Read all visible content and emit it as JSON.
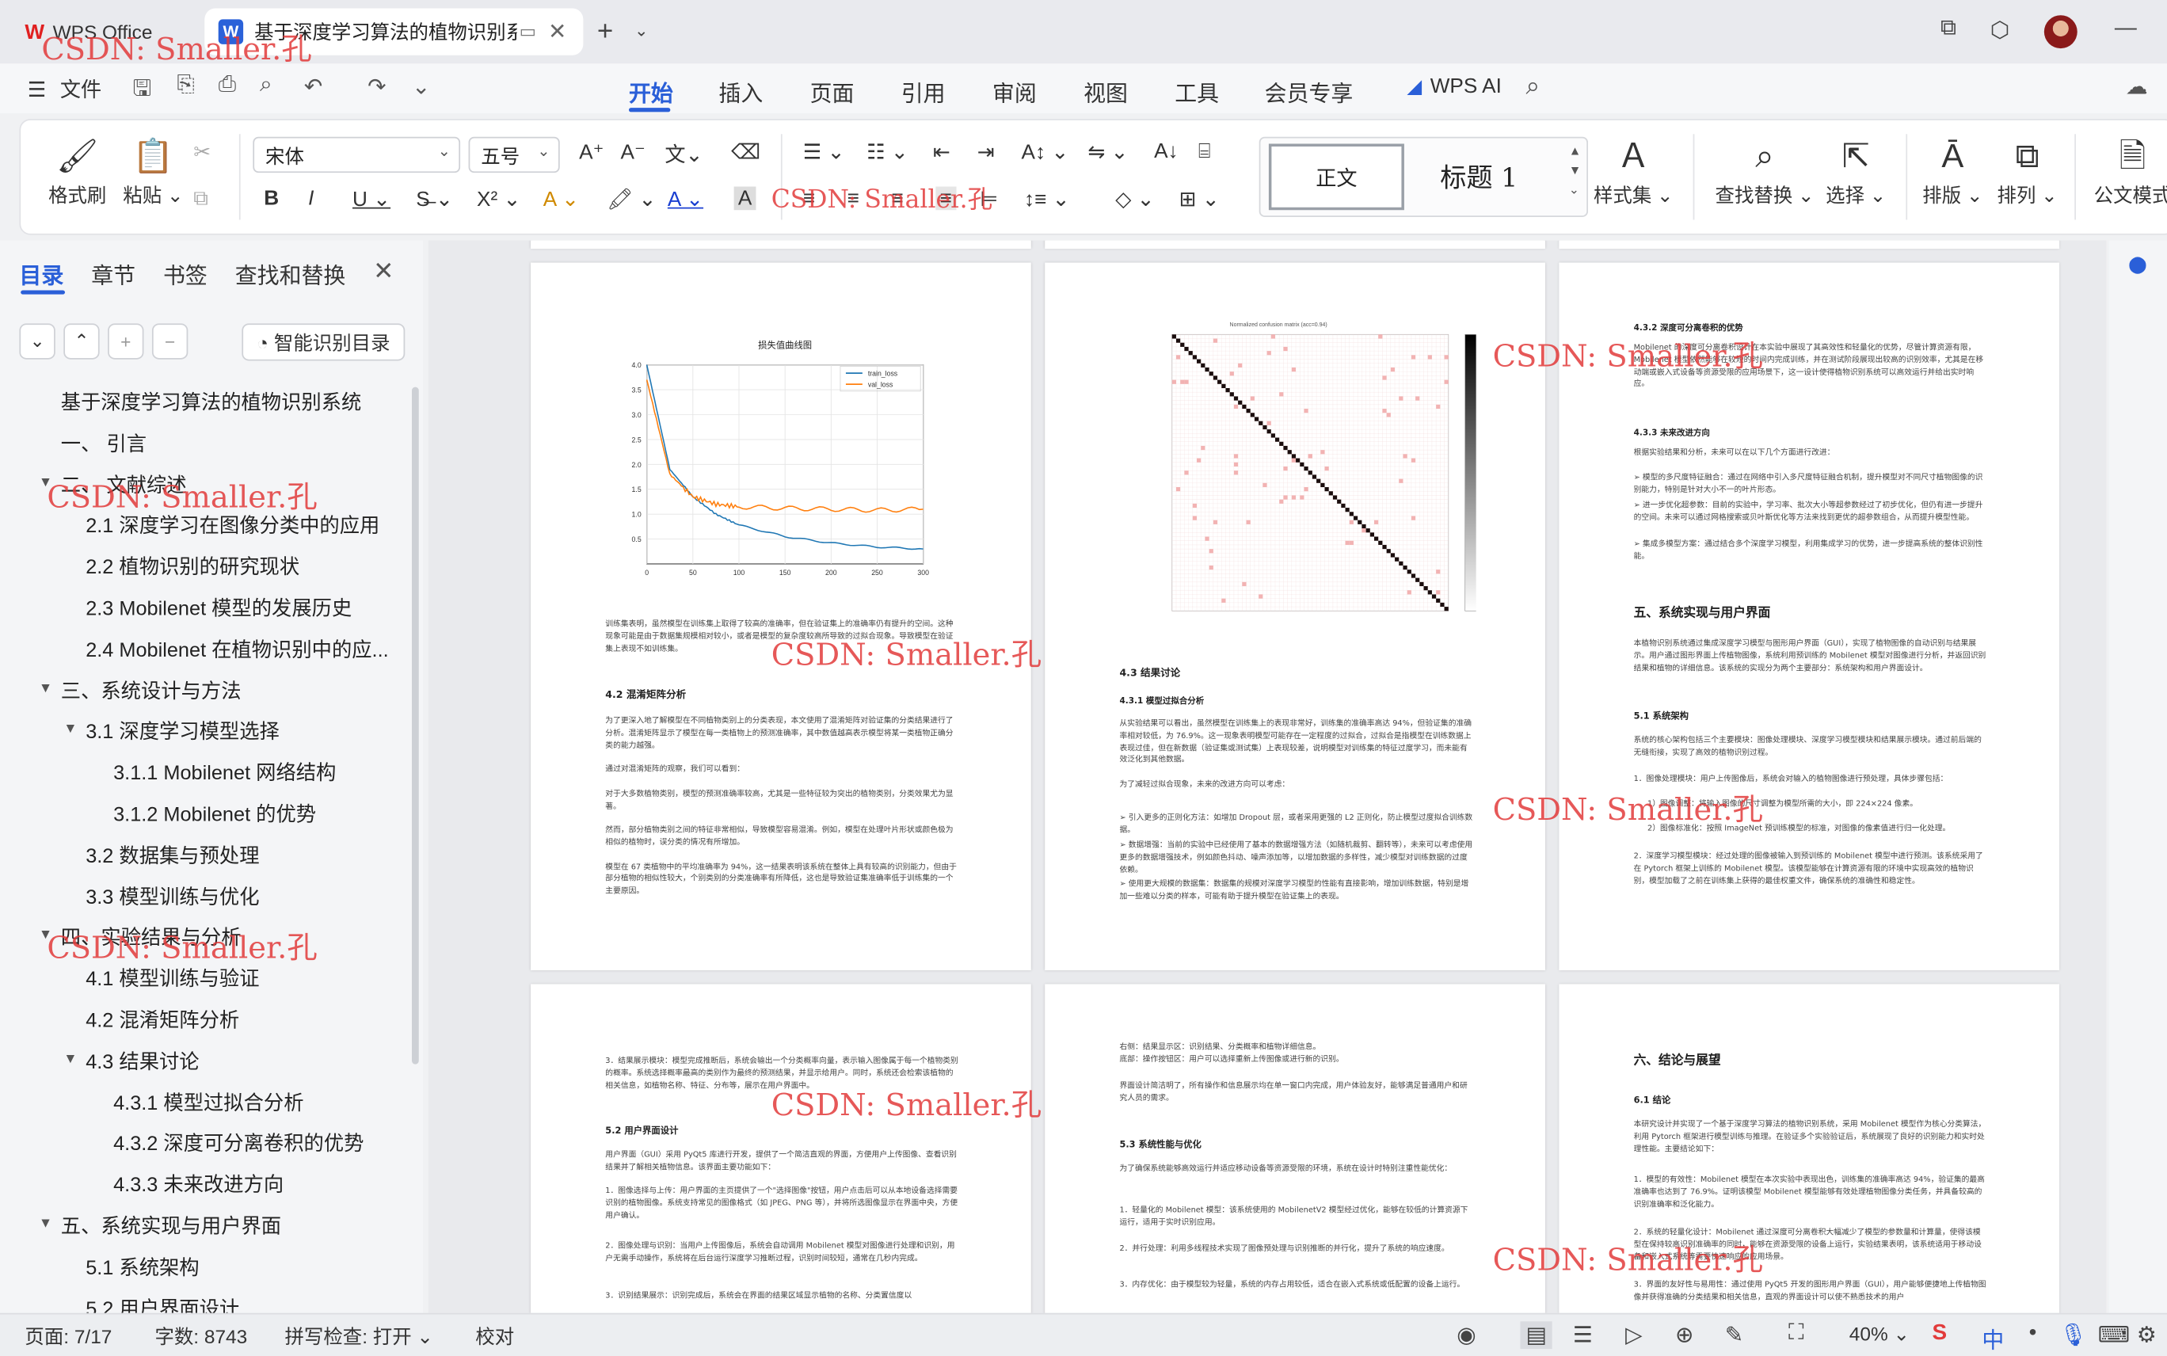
{
  "titlebar": {
    "app_tab": "WPS Office",
    "doc_tab": "基于深度学习算法的植物识别系",
    "new_tab": "+"
  },
  "menu": {
    "file_label": "文件",
    "tabs": [
      "开始",
      "插入",
      "页面",
      "引用",
      "审阅",
      "视图",
      "工具",
      "会员专享"
    ],
    "wps_ai": "WPS AI"
  },
  "ribbon": {
    "format_painter": "格式刷",
    "paste": "粘贴",
    "font_name": "宋体",
    "font_size": "五号",
    "style_normal": "正文",
    "style_h1": "标题 1",
    "styles_set": "样式集",
    "find_replace": "查找替换",
    "select": "选择",
    "layout": "排版",
    "arrange": "排列",
    "official_template": "公文模式"
  },
  "sidepanel": {
    "tabs": [
      "目录",
      "章节",
      "书签",
      "查找和替换"
    ],
    "smart_toc": "智能识别目录",
    "toc": [
      {
        "label": "基于深度学习算法的植物识别系统",
        "level": 0
      },
      {
        "label": "一、 引言",
        "level": 1
      },
      {
        "label": "二、 文献综述",
        "level": 1
      },
      {
        "label": "2.1 深度学习在图像分类中的应用",
        "level": 2
      },
      {
        "label": "2.2 植物识别的研究现状",
        "level": 2
      },
      {
        "label": "2.3 Mobilenet 模型的发展历史",
        "level": 2
      },
      {
        "label": "2.4 Mobilenet 在植物识别中的应...",
        "level": 2
      },
      {
        "label": "三、系统设计与方法",
        "level": 1
      },
      {
        "label": "3.1 深度学习模型选择",
        "level": 2
      },
      {
        "label": "3.1.1 Mobilenet 网络结构",
        "level": 3
      },
      {
        "label": "3.1.2 Mobilenet 的优势",
        "level": 3
      },
      {
        "label": "3.2 数据集与预处理",
        "level": 2
      },
      {
        "label": "3.3 模型训练与优化",
        "level": 2
      },
      {
        "label": "四、实验结果与分析",
        "level": 1
      },
      {
        "label": "4.1 模型训练与验证",
        "level": 2
      },
      {
        "label": "4.2 混淆矩阵分析",
        "level": 2
      },
      {
        "label": "4.3 结果讨论",
        "level": 2
      },
      {
        "label": "4.3.1 模型过拟合分析",
        "level": 3
      },
      {
        "label": "4.3.2 深度可分离卷积的优势",
        "level": 3
      },
      {
        "label": "4.3.3 未来改进方向",
        "level": 3
      },
      {
        "label": "五、系统实现与用户界面",
        "level": 1
      },
      {
        "label": "5.1 系统架构",
        "level": 2
      },
      {
        "label": "5.2 用户界面设计",
        "level": 2
      }
    ]
  },
  "pages": {
    "p1": {
      "chart_title": "损失值曲线图",
      "legend": [
        "train_loss",
        "val_loss"
      ],
      "text1": "训练集表明，虽然模型在训练集上取得了较高的准确率，但在验证集上的准确率仍有提升的空间。这种现象可能是由于数据集规模相对较小，或者是模型的复杂度较高所导致的过拟合现象。导致模型在验证集上表现不如训练集。",
      "h42": "4.2 混淆矩阵分析",
      "text2": "为了更深入地了解模型在不同植物类别上的分类表现，本文使用了混淆矩阵对验证集的分类结果进行了分析。混淆矩阵显示了模型在每一类植物上的预测准确率，其中数值越高表示模型将某一类植物正确分类的能力越强。\n\n通过对混淆矩阵的观察，我们可以看到：\n\n对于大多数植物类别，模型的预测准确率较高，尤其是一些特征较为突出的植物类别，分类效果尤为显著。\n\n然而，部分植物类别之间的特征非常相似，导致模型容易混淆。例如，模型在处理叶片形状或颜色极为相似的植物时，误分类的情况有所增加。\n\n模型在 67 类植物中的平均准确率为 94%，这一结果表明该系统在整体上具有较高的识别能力，但由于部分植物的相似性较大，个别类别的分类准确率有所降低，这也是导致验证集准确率低于训练集的一个主要原因。"
    },
    "p2": {
      "cm_title": "Normalized confusion matrix (acc=0.94)",
      "h43": "4.3 结果讨论",
      "h431": "4.3.1 模型过拟合分析",
      "text1": "从实验结果可以看出，虽然模型在训练集上的表现非常好，训练集的准确率高达 94%，但验证集的准确率相对较低，为 76.9%。这一现象表明模型可能存在一定程度的过拟合，过拟合是指模型在训练数据上表现过佳，但在新数据（验证集或测试集）上表现较差，说明模型对训练集的特征过度学习，而未能有效泛化到其他数据。\n\n为了减轻过拟合现象，未来的改进方向可以考虑：",
      "b1": "引入更多的正则化方法：如增加 Dropout 层，或者采用更强的 L2 正则化，防止模型过度拟合训练数据。",
      "b2": "数据增强：当前的实验中已经使用了基本的数据增强方法（如随机裁剪、翻转等），未来可以考虑使用更多的数据增强技术，例如颜色抖动、噪声添加等，以增加数据的多样性，减少模型对训练数据的过度依赖。",
      "b3": "使用更大规模的数据集：数据集的规模对深度学习模型的性能有直接影响，增加训练数据，特别是增加一些难以分类的样本，可能有助于提升模型在验证集上的表现。"
    },
    "p3": {
      "h432": "4.3.2 深度可分离卷积的优势",
      "text1": "Mobilenet 的深度可分离卷积设计在本实验中展现了其高效性和轻量化的优势，尽管计算资源有限，Mobilenet 模型依然能够在较短的时间内完成训练，并在测试阶段展现出较高的识别效率，尤其是在移动端或嵌入式设备等资源受限的应用场景下，这一设计使得植物识别系统可以高效运行并给出实时响应。",
      "h433": "4.3.3 未来改进方向",
      "text2": "根据实验结果和分析，未来可以在以下几个方面进行改进：",
      "b1": "模型的多尺度特征融合：通过在网络中引入多尺度特征融合机制，提升模型对不同尺寸植物图像的识别能力，特别是针对大小不一的叶片形态。",
      "b2": "进一步优化超参数：目前的实验中，学习率、批次大小等超参数经过了初步优化，但仍有进一步提升的空间。未来可以通过网格搜索或贝叶斯优化等方法来找到更优的超参数组合，从而提升模型性能。",
      "b3": "集成多模型方案：通过结合多个深度学习模型，利用集成学习的优势，进一步提高系统的整体识别性能。",
      "h5": "五、系统实现与用户界面",
      "text3": "本植物识别系统通过集成深度学习模型与图形用户界面（GUI），实现了植物图像的自动识别与结果展示。用户通过图形界面上传植物图像，系统利用预训练的 Mobilenet 模型对图像进行分析，并返回识别结果和植物的详细信息。该系统的实现分为两个主要部分：系统架构和用户界面设计。",
      "h51": "5.1 系统架构",
      "text4": "系统的核心架构包括三个主要模块：图像处理模块、深度学习模型模块和结果展示模块。通过前后端的无缝衔接，实现了高效的植物识别过程。",
      "n1": "1．图像处理模块：用户上传图像后，系统会对输入的植物图像进行预处理，具体步骤包括：",
      "n1a": "1）图像调整：将输入图像的尺寸调整为模型所需的大小，即 224×224 像素。",
      "n1b": "2）图像标准化：按照 ImageNet 预训练模型的标准，对图像的像素值进行归一化处理。",
      "n2": "2．深度学习模型模块：经过处理的图像被输入到预训练的 Mobilenet 模型中进行预测。该系统采用了在 Pytorch 框架上训练的 Mobilenet 模型。该模型能够在计算资源有限的环境中实现高效的植物识别，模型加载了之前在训练集上获得的最佳权重文件，确保系统的准确性和稳定性。"
    },
    "p4": {
      "n3": "3．结果展示模块：模型完成推断后，系统会输出一个分类概率向量，表示输入图像属于每一个植物类别的概率。系统选择概率最高的类别作为最终的预测结果，并显示给用户。同时，系统还会检索该植物的相关信息，如植物名称、特征、分布等，展示在用户界面中。",
      "h52": "5.2 用户界面设计",
      "text1": "用户界面（GUI）采用 PyQt5 库进行开发，提供了一个简洁直观的界面，方便用户上传图像、查看识别结果并了解相关植物信息。该界面主要功能如下：",
      "n1": "1．图像选择与上传：用户界面的主页提供了一个\"选择图像\"按钮，用户点击后可以从本地设备选择需要识别的植物图像。系统支持常见的图像格式（如 JPEG、PNG 等），并将所选图像显示在界面中央，方便用户确认。",
      "n2": "2．图像处理与识别：当用户上传图像后，系统会自动调用 Mobilenet 模型对图像进行处理和识别，用户无需手动操作，系统将在后台运行深度学习推断过程，识别时间较短，通常在几秒内完成。",
      "n3b": "3．识别结果展示：识别完成后，系统会在界面的结果区域显示植物的名称、分类置信度以"
    },
    "p5": {
      "text0": "右侧：结果显示区：识别结果、分类概率和植物详细信息。\n底部：操作按钮区：用户可以选择重新上传图像或进行新的识别。",
      "text1": "界面设计简洁明了，所有操作和信息展示均在单一窗口内完成，用户体验友好，能够满足普通用户和研究人员的需求。",
      "h53": "5.3 系统性能与优化",
      "text2": "为了确保系统能够高效运行并适应移动设备等资源受限的环境，系统在设计时特别注重性能优化：",
      "n1": "1．轻量化的 Mobilenet 模型：该系统使用的 MobilenetV2 模型经过优化，能够在较低的计算资源下运行，适用于实时识别应用。",
      "n2": "2．并行处理：利用多线程技术实现了图像预处理与识别推断的并行化，提升了系统的响应速度。",
      "n3": "3．内存优化：由于模型较为轻量，系统的内存占用较低，适合在嵌入式系统或低配置的设备上运行。"
    },
    "p6": {
      "h6": "六、结论与展望",
      "h61": "6.1 结论",
      "text1": "本研究设计并实现了一个基于深度学习算法的植物识别系统，采用 Mobilenet 模型作为核心分类算法，利用 Pytorch 框架进行模型训练与推理。在验证多个实验验证后，系统展现了良好的识别能力和实时处理性能。主要结论如下：",
      "n1": "1．模型的有效性：Mobilenet 模型在本次实验中表现出色，训练集的准确率高达 94%，验证集的最高准确率也达到了 76.9%。证明该模型 Mobilenet 模型能够有效处理植物图像分类任务，并具备较高的识别准确率和泛化能力。",
      "n2": "2．系统的轻量化设计：Mobilenet 通过深度可分离卷积大幅减少了模型的参数量和计算量，使得该模型在保持较高识别准确率的同时，能够在资源受限的设备上运行，实验结果表明，该系统适用于移动设备和嵌入式系统等需要快速响应的应用场景。",
      "n3": "3．界面的友好性与易用性：通过使用 PyQt5 开发的图形用户界面（GUI），用户能够便捷地上传植物图像并获得准确的分类结果和相关信息，直观的界面设计可以使不熟悉技术的用户"
    }
  },
  "watermark": "CSDN: Smaller.孔",
  "statusbar": {
    "page": "页面: 7/17",
    "words": "字数: 8743",
    "spell": "拼写检查: 打开",
    "proofread": "校对",
    "zoom": "40%"
  },
  "chart_data": [
    {
      "type": "line",
      "title": "损失值曲线图",
      "x": [
        0,
        25,
        50,
        75,
        100,
        150,
        200,
        250,
        300
      ],
      "xlim": [
        0,
        300
      ],
      "ylim": [
        0,
        4.0
      ],
      "series": [
        {
          "name": "train_loss",
          "values": [
            4.0,
            1.9,
            1.35,
            1.0,
            0.78,
            0.55,
            0.42,
            0.34,
            0.3
          ]
        },
        {
          "name": "val_loss",
          "values": [
            3.7,
            1.8,
            1.35,
            1.2,
            1.15,
            1.12,
            1.1,
            1.08,
            1.1
          ]
        }
      ],
      "xticks": [
        0,
        50,
        100,
        150,
        200,
        250,
        300
      ],
      "yticks": [
        0.5,
        1.0,
        1.5,
        2.0,
        2.5,
        3.0,
        3.5,
        4.0
      ],
      "legend": "top-right",
      "grid": true
    },
    {
      "type": "heatmap",
      "title": "Normalized confusion matrix (acc=0.94)",
      "classes": 67,
      "diagonal": "high",
      "colormap": "gray_r"
    }
  ],
  "colors": {
    "accent": "#2a5fd8",
    "train": "#1f77b4",
    "val": "#ff7f0e",
    "watermark": "#e23b3b"
  }
}
